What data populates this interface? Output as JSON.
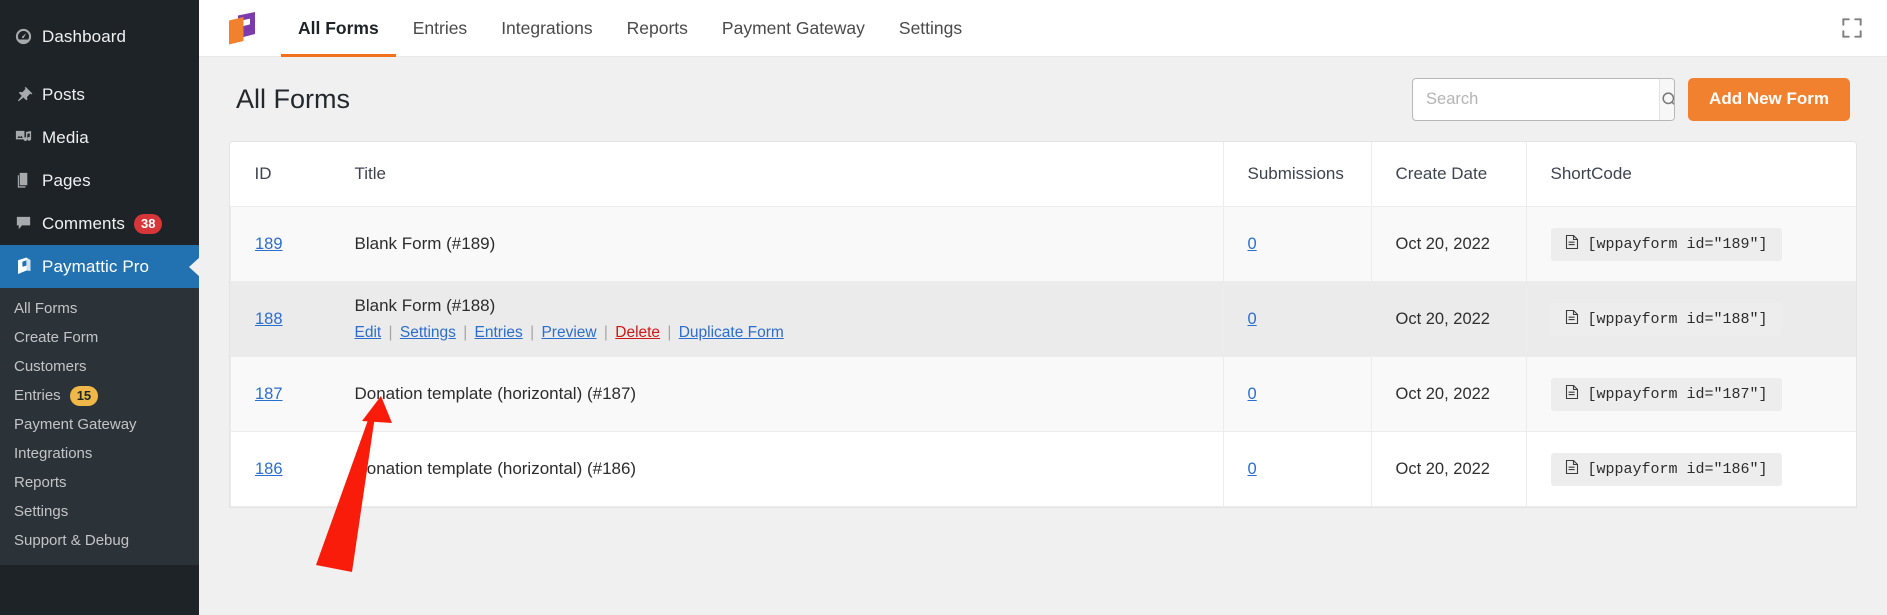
{
  "sidebar": {
    "items": [
      {
        "label": "Dashboard",
        "icon": "dashboard-icon",
        "name": "sidebar-item-dashboard"
      },
      {
        "label": "Posts",
        "icon": "pin-icon",
        "name": "sidebar-item-posts"
      },
      {
        "label": "Media",
        "icon": "media-icon",
        "name": "sidebar-item-media"
      },
      {
        "label": "Pages",
        "icon": "pages-icon",
        "name": "sidebar-item-pages"
      },
      {
        "label": "Comments",
        "icon": "comment-icon",
        "name": "sidebar-item-comments",
        "badge": "38",
        "badge_style": "badge-red"
      },
      {
        "label": "Paymattic Pro",
        "icon": "paymattic-icon",
        "name": "sidebar-item-paymattic-pro",
        "active": true
      }
    ],
    "submenu": [
      {
        "label": "All Forms",
        "name": "submenu-item-all-forms"
      },
      {
        "label": "Create Form",
        "name": "submenu-item-create-form"
      },
      {
        "label": "Customers",
        "name": "submenu-item-customers"
      },
      {
        "label": "Entries",
        "name": "submenu-item-entries",
        "badge": "15",
        "badge_style": "badge-amber"
      },
      {
        "label": "Payment Gateway",
        "name": "submenu-item-payment-gateway"
      },
      {
        "label": "Integrations",
        "name": "submenu-item-integrations"
      },
      {
        "label": "Reports",
        "name": "submenu-item-reports"
      },
      {
        "label": "Settings",
        "name": "submenu-item-settings"
      },
      {
        "label": "Support & Debug",
        "name": "submenu-item-support-debug"
      }
    ]
  },
  "topbar": {
    "logo_icon": "paymattic-logo",
    "fullscreen_icon": "fullscreen-icon",
    "tabs": [
      {
        "label": "All Forms",
        "name": "tab-all-forms",
        "active": true
      },
      {
        "label": "Entries",
        "name": "tab-entries",
        "active": false
      },
      {
        "label": "Integrations",
        "name": "tab-integrations",
        "active": false
      },
      {
        "label": "Reports",
        "name": "tab-reports",
        "active": false
      },
      {
        "label": "Payment Gateway",
        "name": "tab-payment-gateway",
        "active": false
      },
      {
        "label": "Settings",
        "name": "tab-settings",
        "active": false
      }
    ]
  },
  "page": {
    "title": "All Forms",
    "search": {
      "value": "",
      "placeholder": "Search",
      "icon": "search-icon"
    },
    "add_button": "Add New Form"
  },
  "table": {
    "headers": {
      "id": "ID",
      "title": "Title",
      "submissions": "Submissions",
      "create_date": "Create Date",
      "shortcode": "ShortCode"
    },
    "row_actions": {
      "edit": "Edit",
      "settings": "Settings",
      "entries": "Entries",
      "preview": "Preview",
      "delete": "Delete",
      "duplicate": "Duplicate Form",
      "separator": "|"
    },
    "rows": [
      {
        "id": "189",
        "title": "Blank Form (#189)",
        "submissions": "0",
        "create_date": "Oct 20, 2022",
        "shortcode": "[wppayform id=\"189\"]",
        "shortcode_icon": "copy-document-icon",
        "stripe": "r-odd",
        "show_actions": false
      },
      {
        "id": "188",
        "title": "Blank Form (#188)",
        "submissions": "0",
        "create_date": "Oct 20, 2022",
        "shortcode": "[wppayform id=\"188\"]",
        "shortcode_icon": "copy-document-icon",
        "stripe": "r-hover",
        "show_actions": true
      },
      {
        "id": "187",
        "title": "Donation template (horizontal) (#187)",
        "submissions": "0",
        "create_date": "Oct 20, 2022",
        "shortcode": "[wppayform id=\"187\"]",
        "shortcode_icon": "copy-document-icon",
        "stripe": "r-odd",
        "show_actions": false
      },
      {
        "id": "186",
        "title": "Donation template (horizontal) (#186)",
        "submissions": "0",
        "create_date": "Oct 20, 2022",
        "shortcode": "[wppayform id=\"186\"]",
        "shortcode_icon": "copy-document-icon",
        "stripe": "r-even",
        "show_actions": false
      }
    ]
  },
  "annotation": {
    "arrow_icon": "red-arrow-annotation",
    "color": "#f91c0a"
  },
  "colors": {
    "sidebar_bg": "#1d2327",
    "submenu_bg": "#2c3338",
    "active_blue": "#2271b1",
    "accent_orange": "#f2812f",
    "link_blue": "#2c6ecb",
    "danger_red": "#cc1818",
    "badge_red": "#d63638",
    "badge_amber": "#f0b849"
  }
}
